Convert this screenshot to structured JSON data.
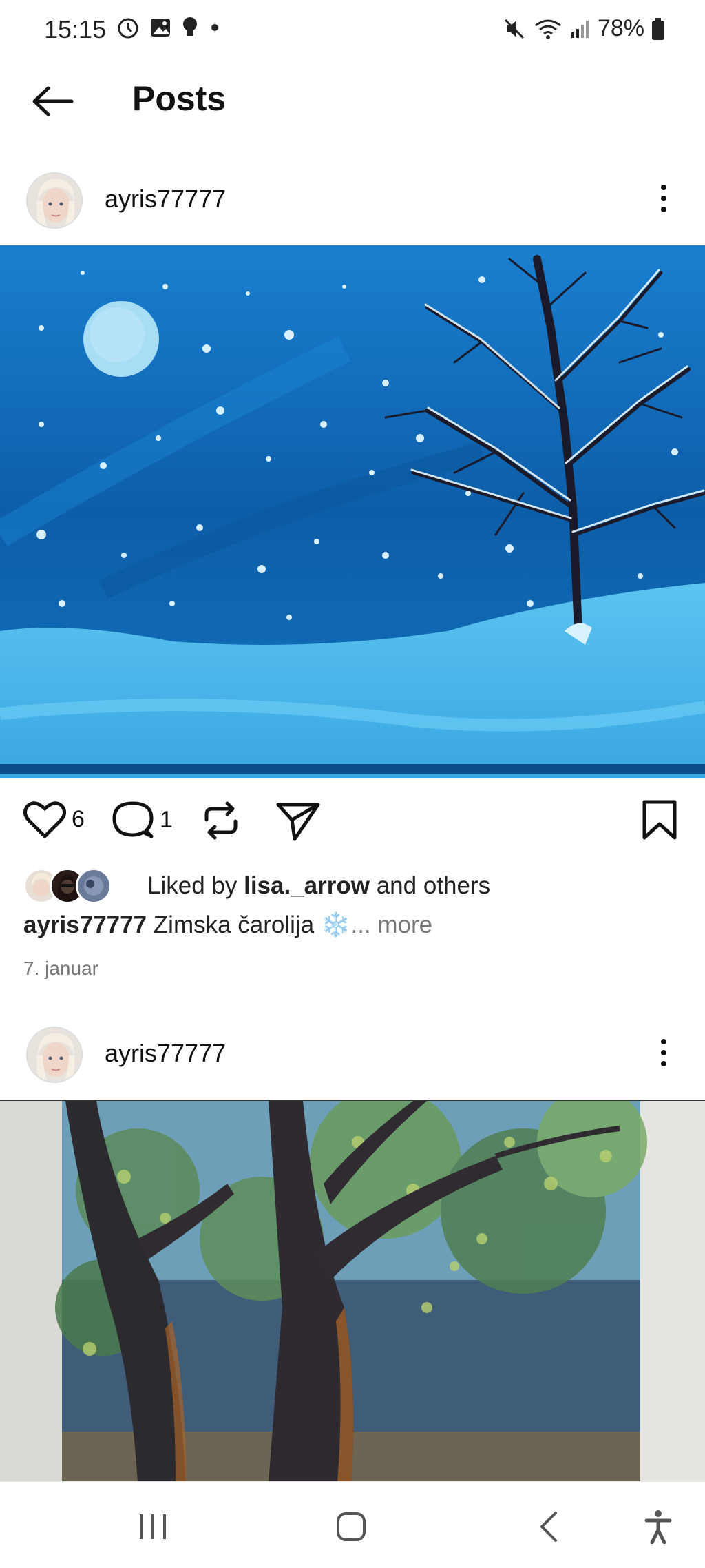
{
  "status_bar": {
    "time": "15:15",
    "battery": "78%"
  },
  "header": {
    "title": "Posts"
  },
  "posts": [
    {
      "username": "ayris77777",
      "likes_count": "6",
      "comments_count": "1",
      "liked_by_prefix": "Liked by ",
      "liked_by_user": "lisa._arrow",
      "liked_by_suffix": " and others",
      "caption_user": "ayris77777",
      "caption_text": " Zimska čarolija ❄️",
      "caption_more": "... more",
      "date": "7. januar"
    },
    {
      "username": "ayris77777"
    }
  ],
  "colors": {
    "accent_sky": "#0f67b0",
    "snow": "#4fb8ec",
    "text": "#111111",
    "muted": "#777777"
  },
  "icons": {
    "like": "heart-icon",
    "comment": "comment-icon",
    "repost": "repost-icon",
    "share": "send-icon",
    "save": "bookmark-icon",
    "back": "back-arrow-icon"
  }
}
